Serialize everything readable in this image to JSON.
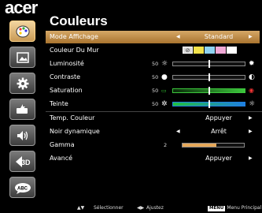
{
  "brand": "acer",
  "title": "Couleurs",
  "sidebar": {
    "items": [
      {
        "icon": "palette-icon",
        "glyph": "🎨",
        "active": true
      },
      {
        "icon": "picture-icon",
        "glyph": "▣"
      },
      {
        "icon": "gear-icon",
        "glyph": "⚙"
      },
      {
        "icon": "power-plug-icon",
        "glyph": "⚡"
      },
      {
        "icon": "speaker-icon",
        "glyph": "🔊"
      },
      {
        "icon": "3d-icon",
        "glyph": "3D"
      },
      {
        "icon": "language-icon",
        "glyph": "ABC"
      }
    ]
  },
  "menu": {
    "mode_affichage": {
      "label": "Mode Affichage",
      "value": "Standard"
    },
    "couleur_du_mur": {
      "label": "Couleur Du Mur",
      "swatches": [
        "#d9d9d9",
        "#f2e24c",
        "#8fd3f2",
        "#f0a9d6",
        "#ffffff"
      ]
    },
    "luminosite": {
      "label": "Luminosité",
      "value": "50",
      "level": 0.5
    },
    "contraste": {
      "label": "Contraste",
      "value": "50",
      "level": 0.5
    },
    "saturation": {
      "label": "Saturation",
      "value": "50",
      "level": 0.5
    },
    "teinte": {
      "label": "Teinte",
      "value": "50",
      "level": 0.5
    },
    "temp_couleur": {
      "label": "Temp. Couleur",
      "value": "Appuyer"
    },
    "noir_dynamique": {
      "label": "Noir dynamique",
      "value": "Arrêt"
    },
    "gamma": {
      "label": "Gamma",
      "value": "2",
      "level": 0.55
    },
    "avance": {
      "label": "Avancé",
      "value": "Appuyer"
    }
  },
  "footer": {
    "select_label": "Sélectionner",
    "adjust_label": "Ajustez",
    "menu_key": "MENU",
    "menu_label": "Menu Principal"
  },
  "colors": {
    "highlight": "#c8924a",
    "saturation_track": "#3cc63c",
    "hue_track": "#1f7fe0",
    "gamma_fill": "#e6a85a"
  }
}
